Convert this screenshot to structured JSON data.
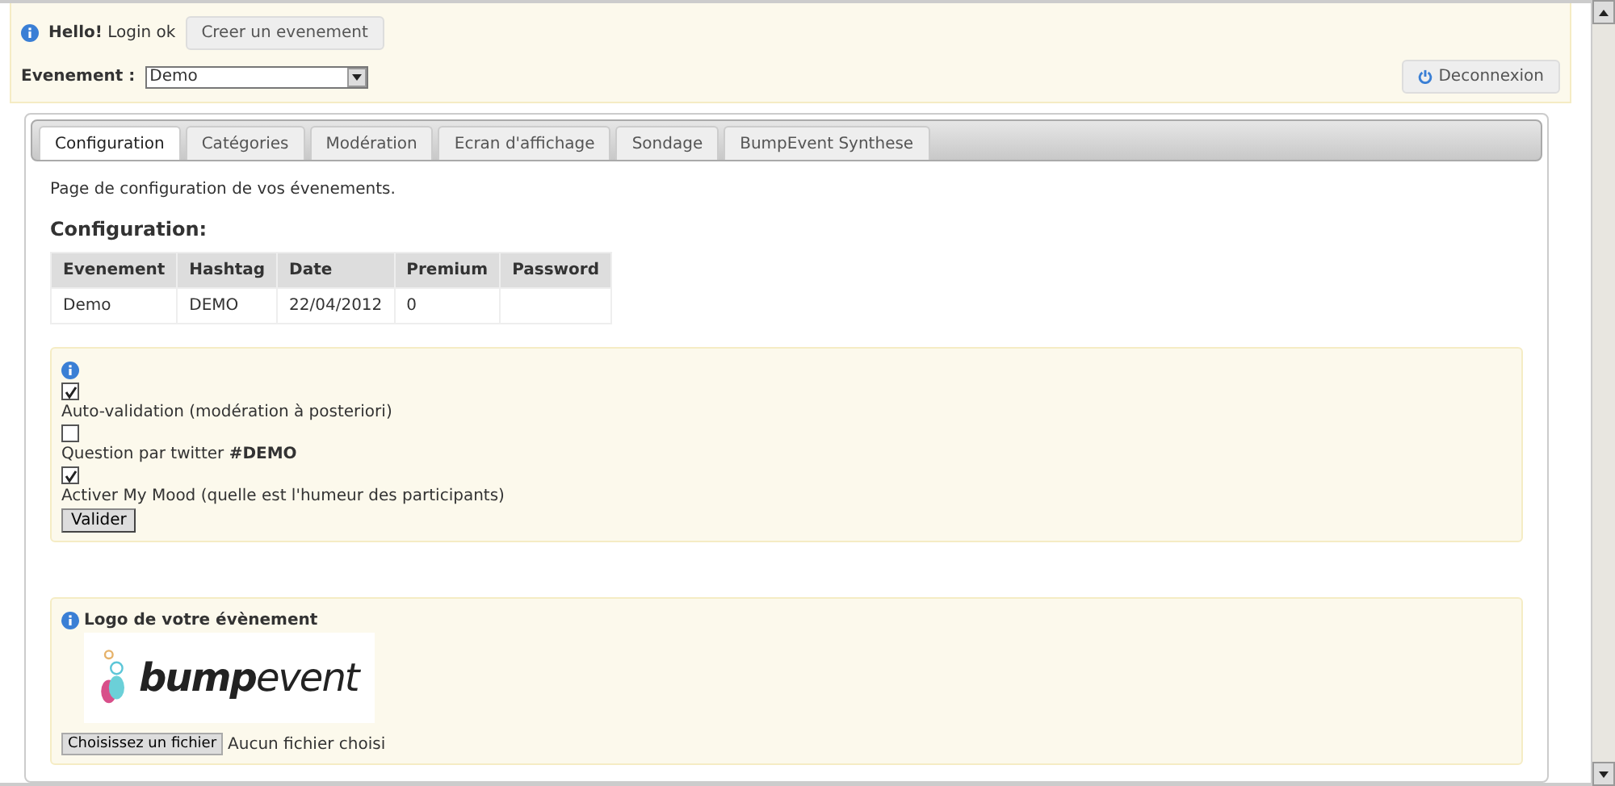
{
  "header": {
    "greeting": "**Hello!** Login ok",
    "create_button": "Creer un evenement",
    "event_label": "Evenement :",
    "event_select": {
      "value": "Demo"
    },
    "logout_button": "Deconnexion"
  },
  "tabs": [
    {
      "label": "Configuration",
      "selected": true
    },
    {
      "label": "Catégories",
      "selected": false
    },
    {
      "label": "Modération",
      "selected": false
    },
    {
      "label": "Ecran d'affichage",
      "selected": false
    },
    {
      "label": "Sondage",
      "selected": false
    },
    {
      "label": "BumpEvent Synthese",
      "selected": false
    }
  ],
  "intro": "Page de configuration de vos évenements.",
  "section_title": "Configuration:",
  "table": {
    "columns": [
      "Evenement",
      "Hashtag",
      "Date",
      "Premium",
      "Password"
    ],
    "rows": [
      [
        "Demo",
        "DEMO",
        "22/04/2012",
        "0",
        ""
      ]
    ]
  },
  "options": [
    {
      "label": "Auto-validation (modération à posteriori)",
      "checked": true
    },
    {
      "label": "Question par twitter **#DEMO**",
      "checked": false
    },
    {
      "label": "Activer My Mood (quelle est l'humeur des participants)",
      "checked": true
    }
  ],
  "submit_button": "Valider",
  "logo_section": {
    "title": "Logo de votre évènement",
    "logo_text": "**bump**event",
    "file_button": "Choisissez un fichier",
    "file_status": "Aucun fichier choisi"
  }
}
